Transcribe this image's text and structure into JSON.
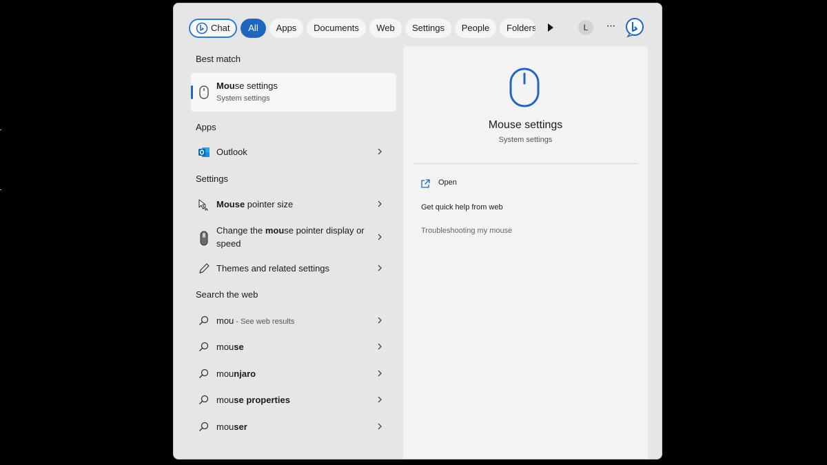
{
  "filter_bar": {
    "chat_label": "Chat",
    "tabs": [
      "All",
      "Apps",
      "Documents",
      "Web",
      "Settings",
      "People",
      "Folders"
    ],
    "avatar_letter": "L",
    "more_label": "···"
  },
  "best_match": {
    "heading": "Best match",
    "title_bold": "Mou",
    "title_rest": "se settings",
    "subtitle": "System settings"
  },
  "apps": {
    "heading": "Apps",
    "items": [
      {
        "label": "Outlook",
        "icon": "outlook-icon"
      }
    ]
  },
  "settings": {
    "heading": "Settings",
    "items": [
      {
        "bold": "Mouse",
        "rest": " pointer size",
        "icon": "mouse-pointer-icon"
      },
      {
        "pre": "Change the ",
        "bold": "mou",
        "rest": "se pointer display or speed",
        "icon": "mouse-device-icon"
      },
      {
        "label": "Themes and related settings",
        "icon": "pen-icon"
      }
    ]
  },
  "web": {
    "heading": "Search the web",
    "items": [
      {
        "plain": "mou",
        "bold": "",
        "suffix": " - See web results"
      },
      {
        "plain": "mou",
        "bold": "se",
        "suffix": ""
      },
      {
        "plain": "mou",
        "bold": "njaro",
        "suffix": ""
      },
      {
        "plain": "mou",
        "bold": "se properties",
        "suffix": ""
      },
      {
        "plain": "mou",
        "bold": "ser",
        "suffix": ""
      }
    ]
  },
  "preview": {
    "title": "Mouse settings",
    "subtitle": "System settings",
    "open_label": "Open",
    "help_label": "Get quick help from web",
    "link_label": "Troubleshooting my mouse"
  },
  "colors": {
    "accent": "#1f66c1",
    "panel": "#e6e6e6",
    "preview": "#f3f3f3"
  }
}
